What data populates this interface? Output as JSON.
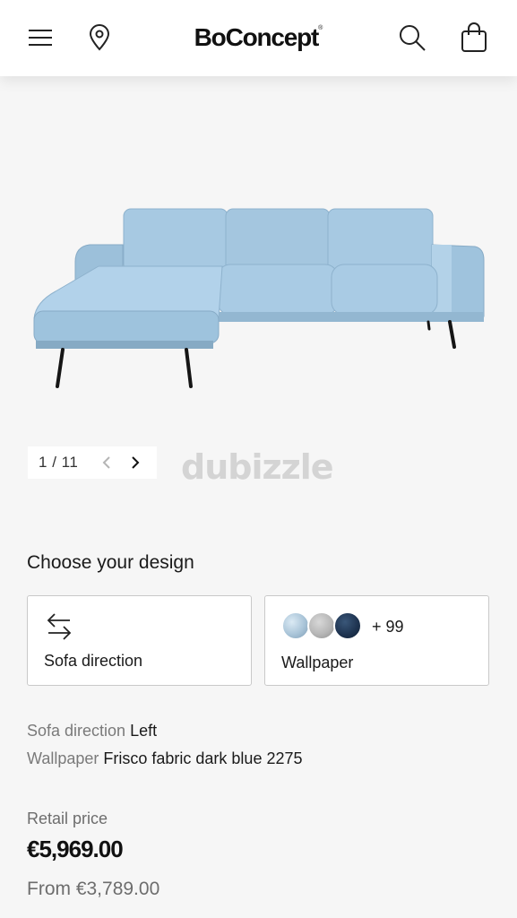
{
  "header": {
    "brand": "BoConcept",
    "brand_mark": "®",
    "icons": [
      "menu-icon",
      "location-pin-icon",
      "search-icon",
      "shopping-bag-icon"
    ]
  },
  "gallery": {
    "current": "1",
    "separator": "/",
    "total": "11",
    "watermark": "dubizzle",
    "image": "blue-sectional-sofa-left-chaise"
  },
  "design": {
    "title": "Choose your design",
    "cards": [
      {
        "label": "Sofa direction",
        "icon": "swap-arrows-icon"
      },
      {
        "label": "Wallpaper",
        "more": "+ 99",
        "swatches": [
          "#a9c4d8",
          "#b7b7b7",
          "#1f3552"
        ]
      }
    ]
  },
  "selection": {
    "direction_key": "Sofa direction",
    "direction_value": "Left",
    "wallpaper_key": "Wallpaper",
    "wallpaper_value": "Frisco fabric dark blue 2275"
  },
  "pricing": {
    "retail_label": "Retail price",
    "price": "€5,969.00",
    "from": "From €3,789.00"
  },
  "colors": {
    "background": "#f6f6f6",
    "sofa_fabric": "#9fc3dd",
    "border": "#c9c9c9"
  }
}
